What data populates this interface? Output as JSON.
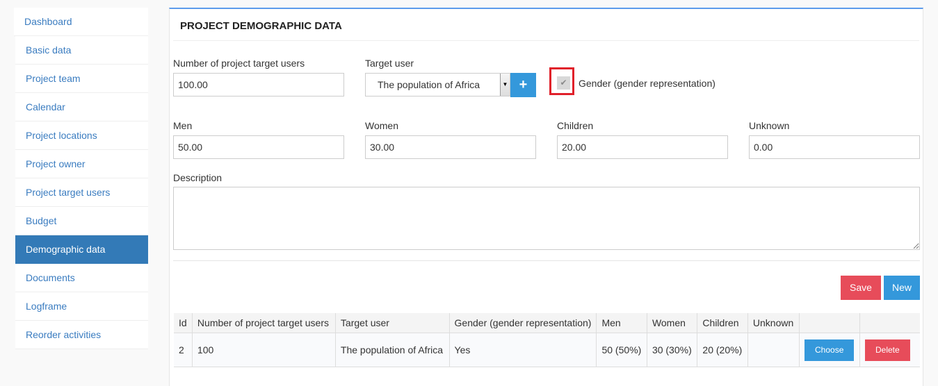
{
  "sidebar": {
    "items": [
      {
        "label": "Dashboard",
        "active": false
      },
      {
        "label": "Basic data",
        "active": false
      },
      {
        "label": "Project team",
        "active": false
      },
      {
        "label": "Calendar",
        "active": false
      },
      {
        "label": "Project locations",
        "active": false
      },
      {
        "label": "Project owner",
        "active": false
      },
      {
        "label": "Project target users",
        "active": false
      },
      {
        "label": "Budget",
        "active": false
      },
      {
        "label": "Demographic data",
        "active": true
      },
      {
        "label": "Documents",
        "active": false
      },
      {
        "label": "Logframe",
        "active": false
      },
      {
        "label": "Reorder activities",
        "active": false
      }
    ]
  },
  "panel": {
    "title": "PROJECT DEMOGRAPHIC DATA"
  },
  "form": {
    "num_users": {
      "label": "Number of project target users",
      "value": "100.00"
    },
    "target_user": {
      "label": "Target user",
      "value": "The population of Africa",
      "add_icon": "plus-icon"
    },
    "gender": {
      "label": "Gender (gender representation)",
      "checked": true,
      "icon": "check-icon"
    },
    "men": {
      "label": "Men",
      "value": "50.00"
    },
    "women": {
      "label": "Women",
      "value": "30.00"
    },
    "children": {
      "label": "Children",
      "value": "20.00"
    },
    "unknown": {
      "label": "Unknown",
      "value": "0.00"
    },
    "description": {
      "label": "Description",
      "value": ""
    }
  },
  "actions": {
    "save_label": "Save",
    "new_label": "New"
  },
  "colors": {
    "primary": "#3498db",
    "danger": "#e74c5a",
    "active_nav": "#337ab7",
    "highlight": "#e0202a"
  },
  "table": {
    "headers": [
      "Id",
      "Number of project target users",
      "Target user",
      "Gender (gender representation)",
      "Men",
      "Women",
      "Children",
      "Unknown",
      "",
      ""
    ],
    "rows": [
      {
        "id": "2",
        "num_users": "100",
        "target_user": "The population of Africa",
        "gender": "Yes",
        "men": "50 (50%)",
        "women": "30 (30%)",
        "children": "20 (20%)",
        "unknown": "",
        "choose_label": "Choose",
        "delete_label": "Delete"
      }
    ]
  }
}
